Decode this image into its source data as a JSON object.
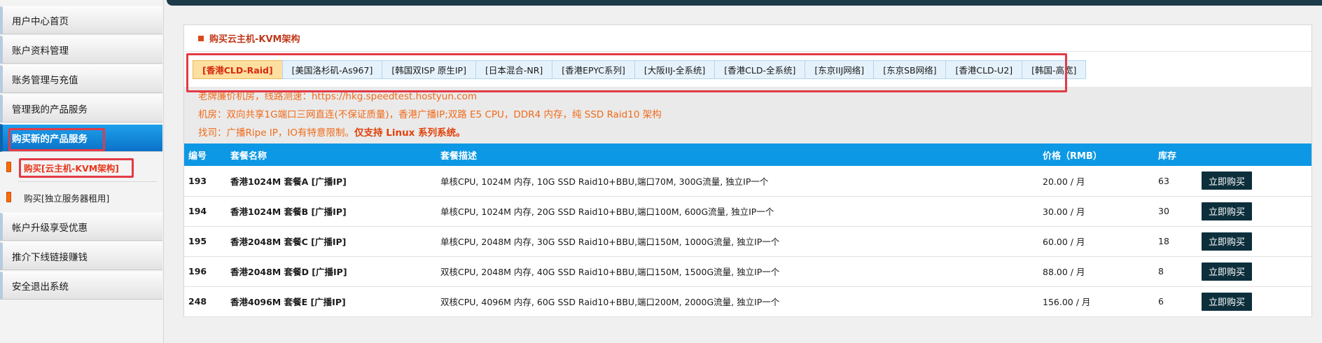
{
  "sidebar": {
    "items": [
      {
        "label": "用户中心首页"
      },
      {
        "label": "账户资料管理"
      },
      {
        "label": "账务管理与充值"
      },
      {
        "label": "管理我的产品服务"
      },
      {
        "label": "购买新的产品服务"
      }
    ],
    "subitems": [
      {
        "label": "购买[云主机-KVM架构]"
      },
      {
        "label": "购买[独立服务器租用]"
      }
    ],
    "items_bottom": [
      {
        "label": "帐户升级享受优惠"
      },
      {
        "label": "推介下线链接赚钱"
      },
      {
        "label": "安全退出系统"
      }
    ]
  },
  "panel": {
    "title": "购买云主机-KVM架构",
    "tabs": [
      {
        "label": "[香港CLD-Raid]"
      },
      {
        "label": "[美国洛杉矶-As967]"
      },
      {
        "label": "[韩国双ISP 原生IP]"
      },
      {
        "label": "[日本混合-NR]"
      },
      {
        "label": "[香港EPYC系列]"
      },
      {
        "label": "[大阪IIJ-全系统]"
      },
      {
        "label": "[香港CLD-全系统]"
      },
      {
        "label": "[东京IIJ网络]"
      },
      {
        "label": "[东京SB网络]"
      },
      {
        "label": "[香港CLD-U2]"
      },
      {
        "label": "[韩国-高宽]"
      }
    ],
    "info": {
      "line1": "老牌廉价机房，线路测速：https://hkg.speedtest.hostyun.com",
      "line2": "机房：双向共享1G端口三网直连(不保证质量)，香港广播IP;双路 E5 CPU，DDR4 内存，纯 SSD Raid10 架构",
      "line3_prefix": "找司：广播Ripe IP，IO有特意限制。",
      "line3_strong": "仅支持 Linux 系列系统。"
    },
    "table": {
      "headers": [
        "编号",
        "套餐名称",
        "套餐描述",
        "价格（RMB）",
        "库存",
        ""
      ],
      "rows": [
        {
          "id": "193",
          "name": "香港1024M 套餐A [广播IP]",
          "desc": "单核CPU, 1024M 内存, 10G SSD Raid10+BBU,端口70M, 300G流量, 独立IP一个",
          "price": "20.00 / 月",
          "stock": "63",
          "buy": "立即购买"
        },
        {
          "id": "194",
          "name": "香港1024M 套餐B [广播IP]",
          "desc": "单核CPU, 1024M 内存, 20G SSD Raid10+BBU,端口100M, 600G流量, 独立IP一个",
          "price": "30.00 / 月",
          "stock": "30",
          "buy": "立即购买"
        },
        {
          "id": "195",
          "name": "香港2048M 套餐C [广播IP]",
          "desc": "单核CPU, 2048M 内存, 30G SSD Raid10+BBU,端口150M, 1000G流量, 独立IP一个",
          "price": "60.00 / 月",
          "stock": "18",
          "buy": "立即购买"
        },
        {
          "id": "196",
          "name": "香港2048M 套餐D [广播IP]",
          "desc": "双核CPU, 2048M 内存, 40G SSD Raid10+BBU,端口150M, 1500G流量, 独立IP一个",
          "price": "88.00 / 月",
          "stock": "8",
          "buy": "立即购买"
        },
        {
          "id": "248",
          "name": "香港4096M 套餐E [广播IP]",
          "desc": "双核CPU, 4096M 内存, 60G SSD Raid10+BBU,端口200M, 2000G流量, 独立IP一个",
          "price": "156.00 / 月",
          "stock": "6",
          "buy": "立即购买"
        }
      ]
    }
  },
  "colors": {
    "accent_blue": "#0c98e4",
    "highlight_red": "#e23b46",
    "info_orange": "#f06b1a",
    "button_dark": "#0d2f3c"
  }
}
